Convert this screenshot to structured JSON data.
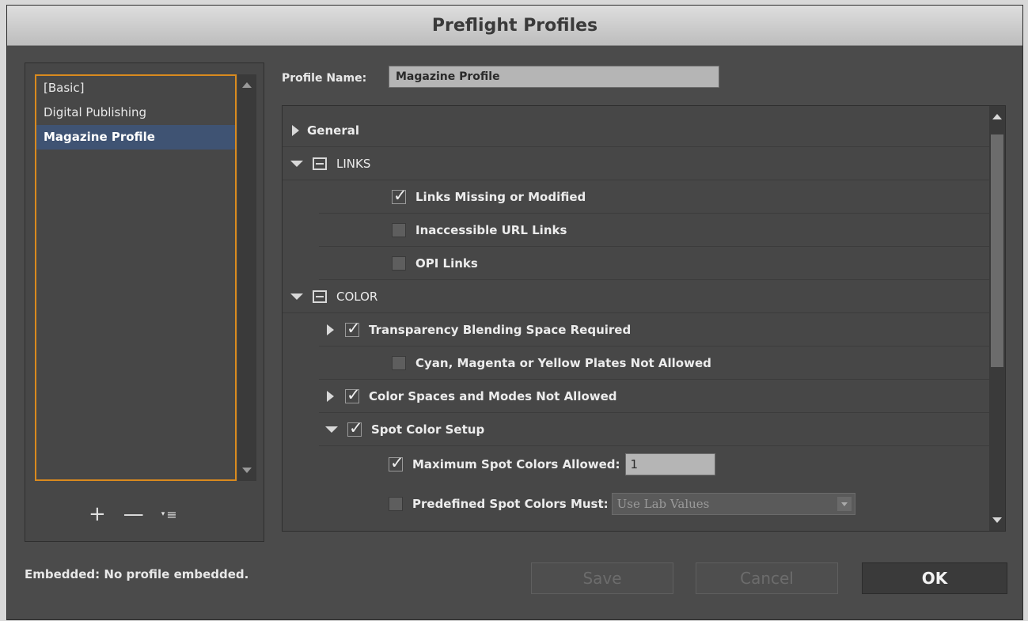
{
  "window": {
    "title": "Preflight Profiles"
  },
  "profiles": {
    "items": [
      {
        "label": "[Basic]"
      },
      {
        "label": "Digital Publishing"
      },
      {
        "label": "Magazine Profile"
      }
    ],
    "selected": "Magazine Profile",
    "tools": {
      "add": "+",
      "remove": "—",
      "menu": "≡"
    }
  },
  "profile_name": {
    "label": "Profile Name:",
    "value": "Magazine Profile"
  },
  "tree": {
    "general": "General",
    "links": {
      "label": "LINKS",
      "items": [
        {
          "label": "Links Missing or Modified",
          "checked": true
        },
        {
          "label": "Inaccessible URL Links",
          "checked": false
        },
        {
          "label": "OPI Links",
          "checked": false
        }
      ]
    },
    "color": {
      "label": "COLOR",
      "items": [
        {
          "label": "Transparency Blending Space Required",
          "checked": true
        },
        {
          "label": "Cyan, Magenta or Yellow Plates Not Allowed",
          "checked": false
        },
        {
          "label": "Color Spaces and Modes Not Allowed",
          "checked": true
        },
        {
          "label": "Spot Color Setup",
          "checked": true
        }
      ],
      "spot": {
        "max_label": "Maximum Spot Colors Allowed:",
        "max_value": "1",
        "predefined_label": "Predefined Spot Colors Must:",
        "predefined_value": "Use Lab Values"
      }
    }
  },
  "footer": {
    "embedded": "Embedded: No profile embedded.",
    "save": "Save",
    "cancel": "Cancel",
    "ok": "OK"
  },
  "colors": {
    "dialog_bg": "#4b4b4b",
    "selection": "#3f5373",
    "focus_border": "#d98a1e"
  }
}
